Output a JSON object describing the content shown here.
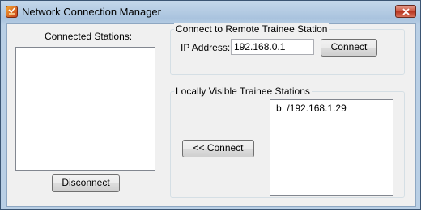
{
  "window": {
    "title": "Network Connection Manager"
  },
  "connected": {
    "label": "Connected Stations:",
    "disconnect_label": "Disconnect"
  },
  "remote": {
    "group_title": "Connect to Remote Trainee Station",
    "ip_label": "IP Address:",
    "ip_value": "192.168.0.1",
    "connect_label": "Connect"
  },
  "local": {
    "group_title": "Locally Visible Trainee Stations",
    "connect_label": "<< Connect",
    "stations": [
      {
        "name": "b",
        "ip": "/192.168.1.29"
      }
    ]
  }
}
